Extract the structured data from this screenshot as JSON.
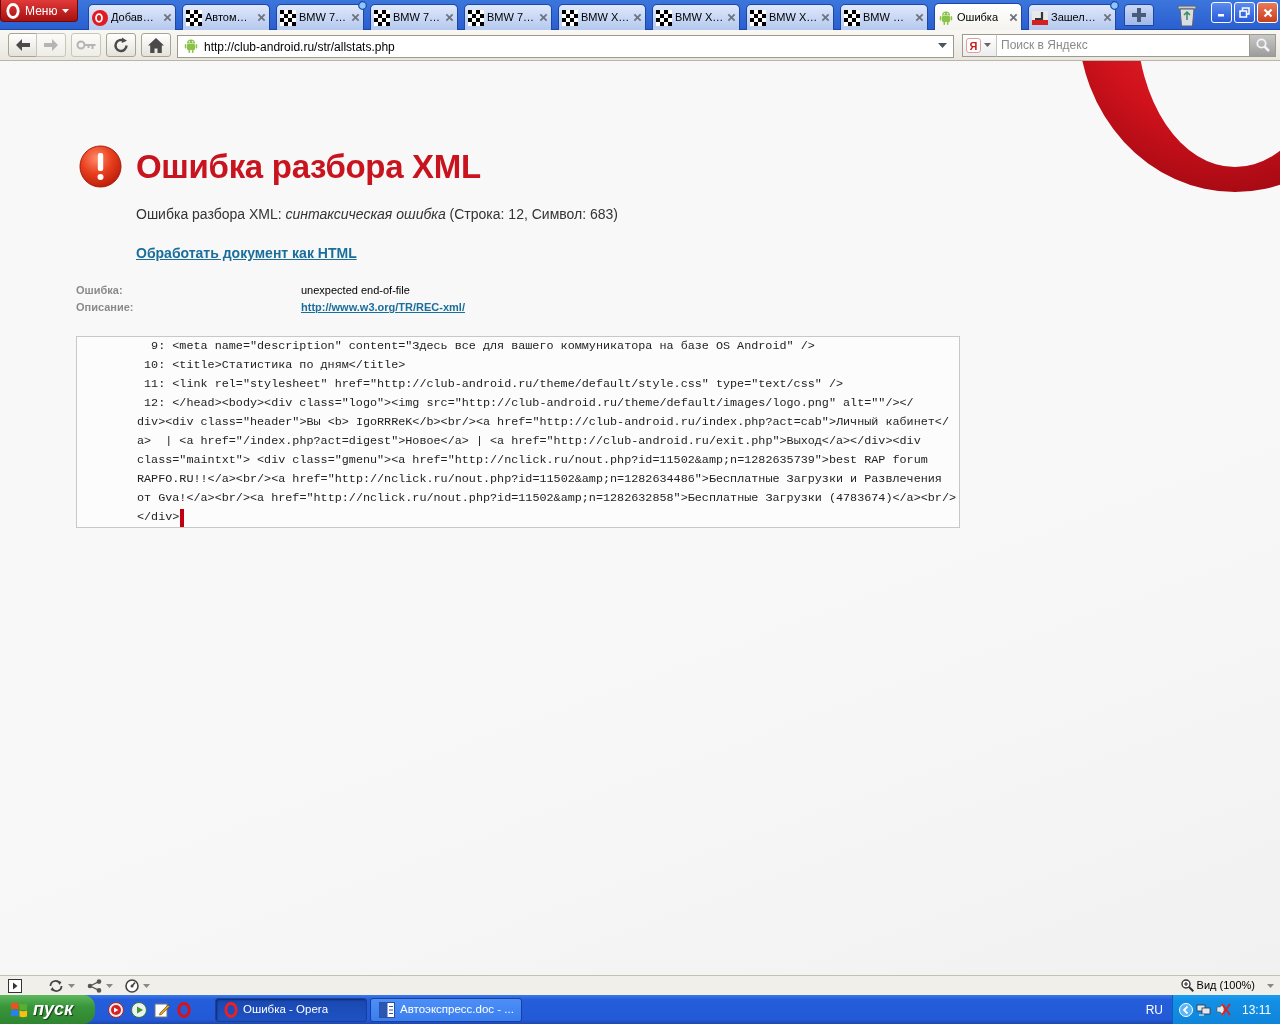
{
  "browser": {
    "menu_button": "Меню",
    "tabs": [
      {
        "title": "Добав…",
        "kind": "opera",
        "selected": false,
        "updated": false
      },
      {
        "title": "Автом…",
        "kind": "checker",
        "selected": false,
        "updated": false
      },
      {
        "title": "BMW 7…",
        "kind": "checker",
        "selected": false,
        "updated": true
      },
      {
        "title": "BMW 7…",
        "kind": "checker",
        "selected": false,
        "updated": false
      },
      {
        "title": "BMW 7…",
        "kind": "checker",
        "selected": false,
        "updated": false
      },
      {
        "title": "BMW X…",
        "kind": "checker",
        "selected": false,
        "updated": false
      },
      {
        "title": "BMW X…",
        "kind": "checker",
        "selected": false,
        "updated": false
      },
      {
        "title": "BMW X…",
        "kind": "checker",
        "selected": false,
        "updated": false
      },
      {
        "title": "BMW …",
        "kind": "checker",
        "selected": false,
        "updated": false
      },
      {
        "title": "Ошибка",
        "kind": "android",
        "selected": true,
        "updated": false
      },
      {
        "title": "Зашел…",
        "kind": "cms",
        "selected": false,
        "updated": true
      }
    ],
    "toolbar": [
      {
        "kind": "back",
        "disabled": false
      },
      {
        "kind": "forward",
        "disabled": true
      },
      {
        "kind": "key",
        "disabled": true
      },
      {
        "kind": "reload",
        "disabled": false
      },
      {
        "kind": "home",
        "disabled": false
      }
    ],
    "address": "http://club-android.ru/str/allstats.php",
    "search": {
      "engine": "Я",
      "placeholder": "Поиск в Яндекс"
    }
  },
  "page": {
    "title": "Ошибка разбора XML",
    "message": "Ошибка разбора XML: *синтаксическая ошибка* (Строка: 12, Символ: 683)",
    "action_link": "Обработать документ как HTML",
    "details": [
      {
        "label": "Ошибка:",
        "value": "unexpected end-of-file",
        "kind": "text"
      },
      {
        "label": "Описание:",
        "value": "http://www.w3.org/TR/REC-xml/",
        "kind": "link"
      }
    ],
    "source": [
      {
        "number": "9:",
        "rows": [
          "<meta name=\"description\" content=\"Здесь все для вашего коммуникатора на базе OS Android\" />"
        ],
        "cursor": false
      },
      {
        "number": "10:",
        "rows": [
          "<title>Статистика по дням</title>"
        ],
        "cursor": false
      },
      {
        "number": "11:",
        "rows": [
          "<link rel=\"stylesheet\" href=\"http://club-android.ru/theme/default/style.css\" type=\"text/css\" />"
        ],
        "cursor": false
      },
      {
        "number": "12:",
        "rows": [
          "</head><body><div class=\"logo\"><img src=\"http://club-android.ru/theme/default/images/logo.png\" alt=\"\"/></",
          "div><div class=\"header\">Вы <b> IgoRRReK</b><br/><a href=\"http://club-android.ru/index.php?act=cab\">Личный кабинет</",
          "a>  | <a href=\"/index.php?act=digest\">Новое</a> | <a href=\"http://club-android.ru/exit.php\">Выход</a></div><div",
          "class=\"maintxt\"> <div class=\"gmenu\"><a href=\"http://nclick.ru/nout.php?id=11502&amp;n=1282635739\">best RAP forum",
          "RAPFO.RU!!</a><br/><a href=\"http://nclick.ru/nout.php?id=11502&amp;n=1282634486\">Бесплатные Загрузки и Развлечения",
          "от Gva!</a><br/><a href=\"http://nclick.ru/nout.php?id=11502&amp;n=1282632858\">Бесплатные Загрузки (4783674)</a><br/>",
          "</div>"
        ],
        "cursor": true
      }
    ]
  },
  "status_bar": {
    "zoom": "Вид (100%)"
  },
  "taskbar": {
    "start": "пуск",
    "tasks": [
      {
        "title": "Ошибка - Opera",
        "kind": "opera",
        "selected": true
      },
      {
        "title": "Автоэкспресс.doc - ...",
        "kind": "word",
        "selected": false
      }
    ],
    "language": "RU",
    "clock": "13:11"
  }
}
